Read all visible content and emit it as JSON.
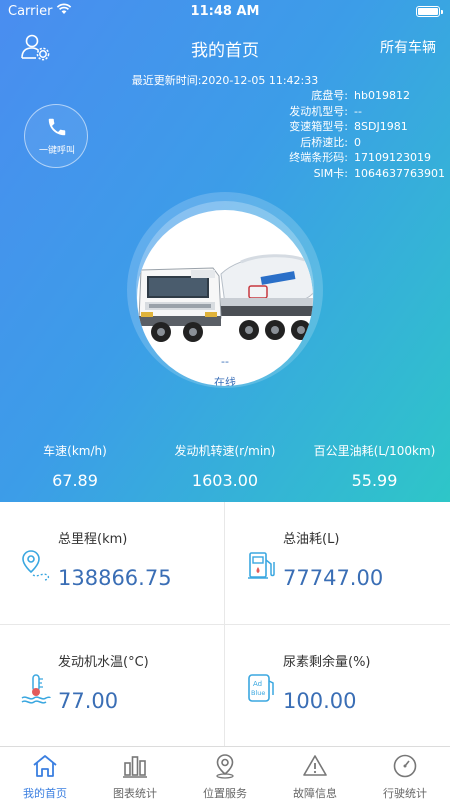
{
  "status_bar": {
    "carrier": "Carrier",
    "time": "11:48 AM"
  },
  "header": {
    "title": "我的首页",
    "all_vehicles": "所有车辆"
  },
  "update_time": "最近更新时间:2020-12-05 11:42:33",
  "vehicle_info": [
    {
      "label": "底盘号:",
      "value": "hb019812"
    },
    {
      "label": "发动机型号:",
      "value": "--"
    },
    {
      "label": "变速箱型号:",
      "value": "8SDJ1981"
    },
    {
      "label": "后桥速比:",
      "value": "0"
    },
    {
      "label": "终端条形码:",
      "value": "17109123019"
    },
    {
      "label": "SIM卡:",
      "value": "1064637763901"
    }
  ],
  "call": {
    "label": "一键呼叫"
  },
  "vehicle": {
    "plate": "--",
    "status": "在线"
  },
  "metrics": [
    {
      "label": "车速(km/h)",
      "value": "67.89"
    },
    {
      "label": "发动机转速(r/min)",
      "value": "1603.00"
    },
    {
      "label": "百公里油耗(L/100km)",
      "value": "55.99"
    }
  ],
  "cards": [
    {
      "label": "总里程(km)",
      "value": "138866.75",
      "icon": "location-route-icon"
    },
    {
      "label": "总油耗(L)",
      "value": "77747.00",
      "icon": "fuel-pump-icon"
    },
    {
      "label": "发动机水温(°C)",
      "value": "77.00",
      "icon": "coolant-temp-icon"
    },
    {
      "label": "尿素剩余量(%)",
      "value": "100.00",
      "icon": "adblue-icon"
    }
  ],
  "tabs": [
    {
      "label": "我的首页",
      "icon": "home-icon",
      "active": true
    },
    {
      "label": "图表统计",
      "icon": "bar-chart-icon",
      "active": false
    },
    {
      "label": "位置服务",
      "icon": "map-pin-icon",
      "active": false
    },
    {
      "label": "故障信息",
      "icon": "warning-icon",
      "active": false
    },
    {
      "label": "行驶统计",
      "icon": "gauge-icon",
      "active": false
    }
  ],
  "colors": {
    "accent": "#3b7fe0",
    "value": "#3a6eb5",
    "icon": "#3aa7e0"
  }
}
